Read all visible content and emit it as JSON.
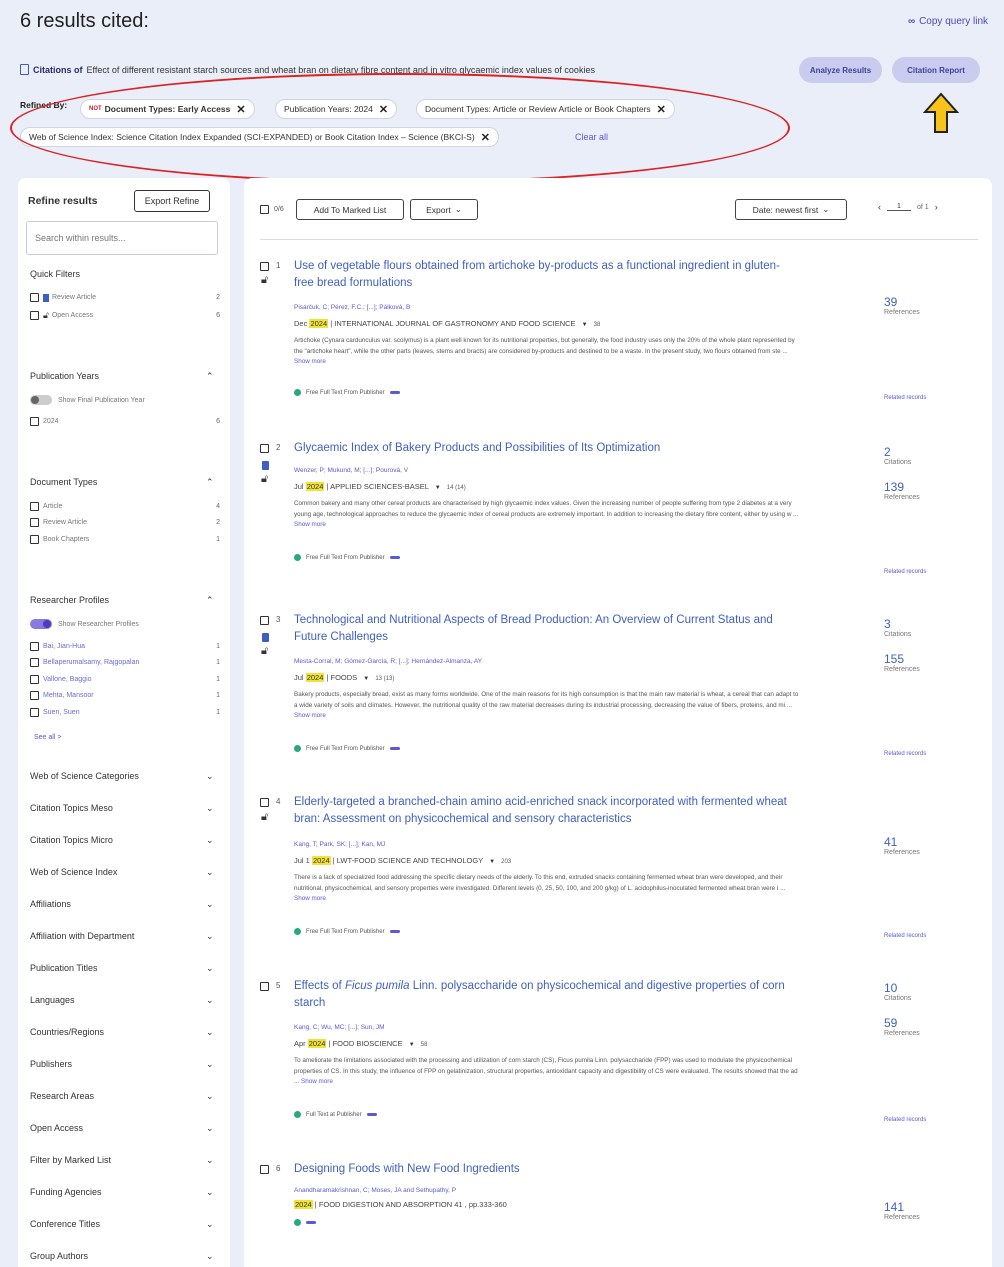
{
  "header": {
    "title": "6 results cited:",
    "copy_link": "Copy query link",
    "citations_of_label": "Citations of",
    "citations_of_text": "Effect of different resistant starch sources and wheat bran on dietary fibre content and in vitro glycaemic index values of cookies",
    "analyze_button": "Analyze Results",
    "citation_report_button": "Citation Report"
  },
  "refined": {
    "label": "Refined By:",
    "chips": [
      {
        "not": "NOT",
        "text": "Document Types: Early Access"
      },
      {
        "text": "Publication Years: 2024"
      },
      {
        "text": "Document Types: Article or Review Article or Book Chapters"
      },
      {
        "text": "Web of Science Index: Science Citation Index Expanded (SCI-EXPANDED) or Book Citation Index – Science (BKCI-S)"
      }
    ],
    "clear_all": "Clear all"
  },
  "sidebar": {
    "title": "Refine results",
    "export_refine": "Export Refine",
    "search_placeholder": "Search within results...",
    "quick_filters": {
      "head": "Quick Filters",
      "items": [
        {
          "label": "Review Article",
          "count": "2"
        },
        {
          "label": "Open Access",
          "count": "6"
        }
      ]
    },
    "pub_years": {
      "head": "Publication Years",
      "toggle": "Show Final Publication Year",
      "items": [
        {
          "label": "2024",
          "count": "6"
        }
      ]
    },
    "doc_types": {
      "head": "Document Types",
      "items": [
        {
          "label": "Article",
          "count": "4"
        },
        {
          "label": "Review Article",
          "count": "2"
        },
        {
          "label": "Book Chapters",
          "count": "1"
        }
      ]
    },
    "researchers": {
      "head": "Researcher Profiles",
      "toggle": "Show Researcher Profiles",
      "items": [
        {
          "label": "Bai, Jian-Hua",
          "count": "1"
        },
        {
          "label": "Bellaperumalsamy, Rajgopalan",
          "count": "1"
        },
        {
          "label": "Vallone, Baggio",
          "count": "1"
        },
        {
          "label": "Mehta, Mansoor",
          "count": "1"
        },
        {
          "label": "Suen, Suen",
          "count": "1"
        }
      ],
      "see_all": "See all >"
    },
    "sections": [
      "Web of Science Categories",
      "Citation Topics Meso",
      "Citation Topics Micro",
      "Web of Science Index",
      "Affiliations",
      "Affiliation with Department",
      "Publication Titles",
      "Languages",
      "Countries/Regions",
      "Publishers",
      "Research Areas",
      "Open Access",
      "Filter by Marked List",
      "Funding Agencies",
      "Conference Titles",
      "Group Authors"
    ]
  },
  "toolbar": {
    "count": "0/6",
    "add_marked": "Add To Marked List",
    "export": "Export",
    "sort": "Date: newest first",
    "page": "1",
    "of_pages": "of 1"
  },
  "records": [
    {
      "num": "1",
      "title": "Use of vegetable flours obtained from artichoke by-products as a functional ingredient in gluten-free bread formulations",
      "authors": "Pisarčuk, C; Pérez, F.C.; [...]; Pálková, B",
      "date": "Dec",
      "year": "2024",
      "source": "| INTERNATIONAL JOURNAL OF GASTRONOMY AND FOOD SCIENCE",
      "vol": "38",
      "abstract": "Artichoke (Cynara cardunculus var. scolymus) is a plant well known for its nutritional properties, but generally, the food industry uses only the 20% of the whole plant represented by the \"artichoke heart\", while the other parts (leaves, stems and bracts) are considered by-products and destined to be a waste. In the present study, two flours obtained from ste ...",
      "more": "Show more",
      "fulltext": "Free Full Text From Publisher",
      "metrics": [
        {
          "n": "39",
          "l": "References"
        }
      ],
      "related": "Related records"
    },
    {
      "num": "2",
      "title": "Glycaemic Index of Bakery Products and Possibilities of Its Optimization",
      "authors": "Wenzer, P; Mukund, M; [...]; Pourová, V",
      "date": "Jul",
      "year": "2024",
      "source": "| APPLIED SCIENCES-BASEL",
      "vol": "14 (14)",
      "abstract": "Common bakery and many other cereal products are characterised by high glycaemic index values. Given the increasing number of people suffering from type 2 diabetes at a very young age, technological approaches to reduce the glycaemic index of cereal products are extremely important. In addition to increasing the dietary fibre content, either by using w ...",
      "more": "Show more",
      "fulltext": "Free Full Text From Publisher",
      "metrics": [
        {
          "n": "2",
          "l": "Citations"
        },
        {
          "n": "139",
          "l": "References"
        }
      ],
      "related": "Related records"
    },
    {
      "num": "3",
      "title": "Technological and Nutritional Aspects of Bread Production: An Overview of Current Status and Future Challenges",
      "authors": "Mesta-Corral, M; Gómez-García, R; [...]; Hernández-Almanza, AY",
      "date": "Jul",
      "year": "2024",
      "source": "| FOODS",
      "vol": "13 (13)",
      "abstract": "Bakery products, especially bread, exist as many forms worldwide. One of the main reasons for its high consumption is that the main raw material is wheat, a cereal that can adapt to a wide variety of soils and climates. However, the nutritional quality of the raw material decreases during its industrial processing, decreasing the value of fibers, proteins, and mi ...",
      "more": "Show more",
      "fulltext": "Free Full Text From Publisher",
      "metrics": [
        {
          "n": "3",
          "l": "Citations"
        },
        {
          "n": "155",
          "l": "References"
        }
      ],
      "related": "Related records"
    },
    {
      "num": "4",
      "title": "Elderly-targeted a branched-chain amino acid-enriched snack incorporated with fermented wheat bran: Assessment on physicochemical and sensory characteristics",
      "authors": "Kang, T; Park, SK; [...]; Kan, MJ",
      "date": "Jul 1",
      "year": "2024",
      "source": "| LWT-FOOD SCIENCE AND TECHNOLOGY",
      "vol": "203",
      "abstract": "There is a lack of specialized food addressing the specific dietary needs of the elderly. To this end, extruded snacks containing fermented wheat bran were developed, and their nutritional, physicochemical, and sensory properties were investigated. Different levels (0, 25, 50, 100, and 200 g/kg) of L. acidophilus-inoculated fermented wheat bran were i ...",
      "more": "Show more",
      "fulltext": "Free Full Text From Publisher",
      "metrics": [
        {
          "n": "41",
          "l": "References"
        }
      ],
      "related": "Related records"
    },
    {
      "num": "5",
      "title_pre": "Effects of ",
      "title_italic": "Ficus pumila",
      "title_post": " Linn. polysaccharide on physicochemical and digestive properties of corn starch",
      "authors": "Kang, C; Wu, MC; [...]; Sun, JM",
      "date": "Apr",
      "year": "2024",
      "source": "| FOOD BIOSCIENCE",
      "vol": "58",
      "abstract": "To ameliorate the limitations associated with the processing and utilization of corn starch (CS), Ficus pumila Linn. polysaccharide (FPP) was used to modulate the physicochemical properties of CS. In this study, the influence of FPP on gelatinization, structural properties, antioxidant capacity and digestibility of CS were evaluated. The results showed that the ad ...",
      "more": "Show more",
      "fulltext": "Full Text at Publisher",
      "metrics": [
        {
          "n": "10",
          "l": "Citations"
        },
        {
          "n": "59",
          "l": "References"
        }
      ],
      "related": "Related records"
    },
    {
      "num": "6",
      "title": "Designing Foods with New Food Ingredients",
      "authors": "Anandharamakrishnan, C; Moses, JA and Sethupathy, P",
      "year": "2024",
      "source": "| FOOD DIGESTION AND ABSORPTION 41 , pp.333-360",
      "metrics": [
        {
          "n": "141",
          "l": "References"
        }
      ]
    }
  ]
}
